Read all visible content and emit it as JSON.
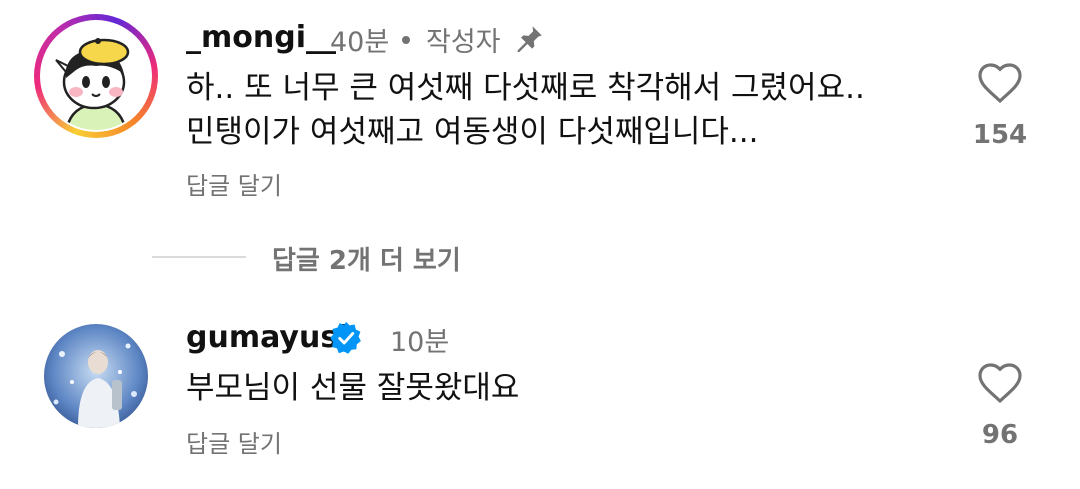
{
  "comments": [
    {
      "username": "_mongi__",
      "time": "40분",
      "author_badge": "작성자",
      "pinned": true,
      "text_lines": [
        "하.. 또 너무 큰 여섯째 다섯째로 착각해서 그렸어요..",
        "민탱이가 여섯째고 여동생이 다섯째입니다..."
      ],
      "reply_label": "답글 달기",
      "likes": "154",
      "avatar_icon": "cartoon-character-with-beret-avatar",
      "has_story_ring": true
    },
    {
      "username": "gumayusi",
      "verified": true,
      "time": "10분",
      "text": "부모님이 선물 잘못왔대요",
      "reply_label": "답글 달기",
      "likes": "96",
      "avatar_icon": "person-photo-avatar"
    }
  ],
  "view_replies": "답글 2개 더 보기",
  "colors": {
    "text": "#111111",
    "secondary": "#737373",
    "verified": "#0095f6",
    "divider": "#dbdbdb"
  }
}
